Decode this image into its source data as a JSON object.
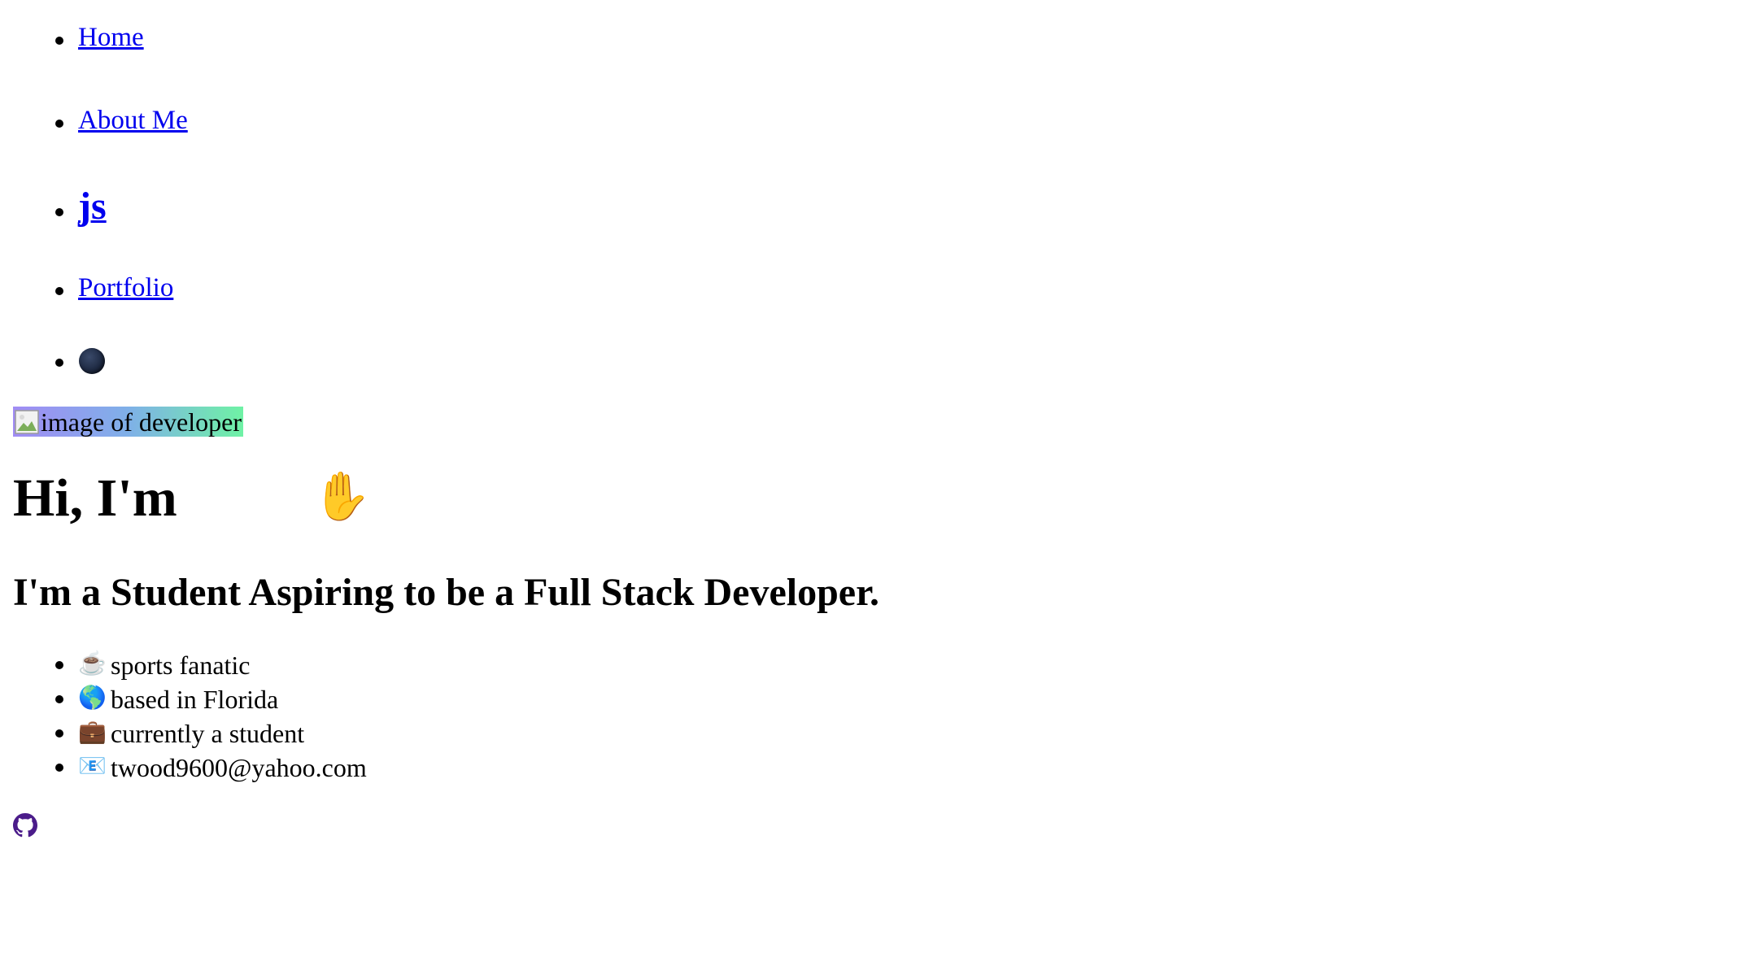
{
  "nav": {
    "items": [
      {
        "label": "Home"
      },
      {
        "label": "About Me"
      },
      {
        "label": "js"
      },
      {
        "label": "Portfolio"
      }
    ],
    "theme_toggle_icon": "moon-icon"
  },
  "hero": {
    "image_alt": "image of developer",
    "greeting": "Hi, I'm",
    "wave_icon": "waving-hand-icon",
    "wave_emoji": "✋",
    "tagline": "I'm a Student Aspiring to be a Full Stack Developer."
  },
  "info": {
    "items": [
      {
        "emoji": "☕",
        "icon": "coffee-icon",
        "text": "sports fanatic"
      },
      {
        "emoji": "🌎",
        "icon": "globe-icon",
        "text": "based in Florida"
      },
      {
        "emoji": "💼",
        "icon": "briefcase-icon",
        "text": "currently a student"
      },
      {
        "emoji": "📧",
        "icon": "email-icon",
        "text": "twood9600@yahoo.com"
      }
    ]
  },
  "social": {
    "github_icon": "github-icon"
  },
  "colors": {
    "link": "#0000ee",
    "github": "#4b1c8a",
    "image_gradient_start": "#a18cf5",
    "image_gradient_end": "#6ff2a5"
  }
}
